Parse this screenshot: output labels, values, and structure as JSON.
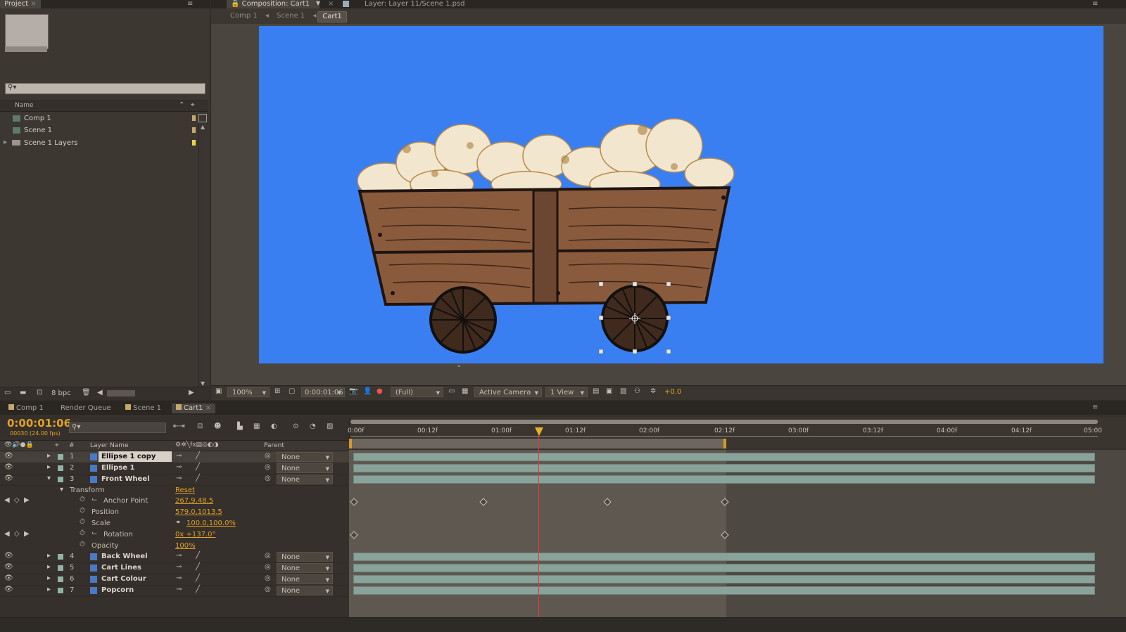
{
  "project_panel": {
    "tab_label": "Project",
    "column_name": "Name",
    "items": [
      {
        "label": "Comp 1",
        "type": "comp"
      },
      {
        "label": "Scene 1",
        "type": "comp"
      },
      {
        "label": "Scene 1 Layers",
        "type": "folder"
      }
    ],
    "bit_depth": "8 bpc"
  },
  "comp_panel": {
    "tab_label": "Composition: Cart1",
    "layer_tab_label": "Layer: Layer 11/Scene 1.psd",
    "breadcrumbs": [
      "Comp 1",
      "Scene 1",
      "Cart1"
    ],
    "bg_color": "#3a7ff2",
    "footer": {
      "zoom": "100%",
      "timecode": "0:00:01:06",
      "resolution": "(Full)",
      "camera": "Active Camera",
      "view": "1 View",
      "exposure": "+0.0"
    }
  },
  "timeline": {
    "tabs": [
      "Comp 1",
      "Render Queue",
      "Scene 1",
      "Cart1"
    ],
    "current_time": "0:00:01:06",
    "frame_info": "00030 (24.00 fps)",
    "columns": {
      "layer_name": "Layer Name",
      "parent": "Parent",
      "hash": "#"
    },
    "ruler": [
      "0:00f",
      "00:12f",
      "01:00f",
      "01:12f",
      "02:00f",
      "02:12f",
      "03:00f",
      "03:12f",
      "04:00f",
      "04:12f",
      "05:00"
    ],
    "layers": [
      {
        "num": "1",
        "name": "Ellipse 1 copy",
        "parent": "None"
      },
      {
        "num": "2",
        "name": "Ellipse 1",
        "parent": "None"
      },
      {
        "num": "3",
        "name": "Front Wheel",
        "parent": "None"
      },
      {
        "num": "4",
        "name": "Back Wheel",
        "parent": "None"
      },
      {
        "num": "5",
        "name": "Cart Lines",
        "parent": "None"
      },
      {
        "num": "6",
        "name": "Cart Colour",
        "parent": "None"
      },
      {
        "num": "7",
        "name": "Popcorn",
        "parent": "None"
      }
    ],
    "transform": {
      "label": "Transform",
      "reset": "Reset",
      "props": [
        {
          "name": "Anchor Point",
          "value": "267.9,48.5"
        },
        {
          "name": "Position",
          "value": "579.0,1013.5"
        },
        {
          "name": "Scale",
          "value": "100.0,100.0%"
        },
        {
          "name": "Rotation",
          "value": "0x +137.0°"
        },
        {
          "name": "Opacity",
          "value": "100%"
        }
      ]
    }
  }
}
